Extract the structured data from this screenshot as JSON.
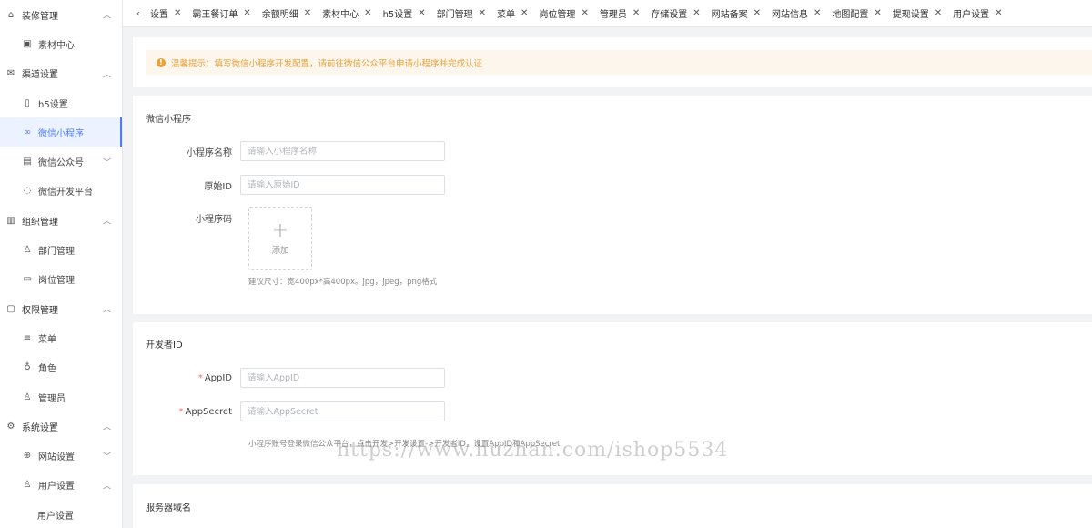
{
  "sidebar": {
    "items": [
      {
        "label": "装修管理",
        "icon": "shop-icon",
        "kind": "group",
        "chevron": "up"
      },
      {
        "label": "素材中心",
        "icon": "image-icon",
        "kind": "item"
      },
      {
        "label": "渠道设置",
        "icon": "mail-icon",
        "kind": "group",
        "chevron": "up"
      },
      {
        "label": "h5设置",
        "icon": "mobile-icon",
        "kind": "item"
      },
      {
        "label": "微信小程序",
        "icon": "miniprogram-icon",
        "kind": "item",
        "active": true
      },
      {
        "label": "微信公众号",
        "icon": "document-icon",
        "kind": "item",
        "chevron": "down"
      },
      {
        "label": "微信开发平台",
        "icon": "chat-icon",
        "kind": "item"
      },
      {
        "label": "组织管理",
        "icon": "building-icon",
        "kind": "group",
        "chevron": "up"
      },
      {
        "label": "部门管理",
        "icon": "user-icon",
        "kind": "item"
      },
      {
        "label": "岗位管理",
        "icon": "briefcase-icon",
        "kind": "item"
      },
      {
        "label": "权限管理",
        "icon": "lock-icon",
        "kind": "group",
        "chevron": "up"
      },
      {
        "label": "菜单",
        "icon": "sliders-icon",
        "kind": "item"
      },
      {
        "label": "角色",
        "icon": "location-icon",
        "kind": "item"
      },
      {
        "label": "管理员",
        "icon": "person-icon",
        "kind": "item"
      },
      {
        "label": "系统设置",
        "icon": "gear-icon",
        "kind": "group",
        "chevron": "up"
      },
      {
        "label": "网站设置",
        "icon": "globe-icon",
        "kind": "item",
        "chevron": "down"
      },
      {
        "label": "用户设置",
        "icon": "users-icon",
        "kind": "item",
        "chevron": "up"
      },
      {
        "label": "用户设置",
        "icon": "",
        "kind": "sub2"
      }
    ]
  },
  "tabs": [
    "设置",
    "霸王餐订单",
    "余额明细",
    "素材中心",
    "h5设置",
    "部门管理",
    "菜单",
    "岗位管理",
    "管理员",
    "存储设置",
    "网站备案",
    "网站信息",
    "地图配置",
    "提现设置",
    "用户设置"
  ],
  "alert": {
    "text": "温馨提示：填写微信小程序开发配置，请前往微信公众平台申请小程序并完成认证"
  },
  "mini_program": {
    "title": "微信小程序",
    "name_label": "小程序名称",
    "name_placeholder": "请输入小程序名称",
    "origin_label": "原始ID",
    "origin_placeholder": "请输入原始ID",
    "code_label": "小程序码",
    "upload_label": "添加",
    "help": "建议尺寸：宽400px*高400px。jpg，jpeg，png格式"
  },
  "developer": {
    "title": "开发者ID",
    "appid_label": "AppID",
    "appid_placeholder": "请输入AppID",
    "secret_label": "AppSecret",
    "secret_placeholder": "请输入AppSecret",
    "help": "小程序账号登录微信公众平台，点击开发>开发设置->开发者ID，设置AppID和AppSecret"
  },
  "server": {
    "title": "服务器域名"
  },
  "watermark": "https://www.huzhan.com/ishop5534",
  "colors": {
    "accent": "#4d7cfe",
    "warning": "#e6a23c",
    "required": "#f56c6c"
  }
}
